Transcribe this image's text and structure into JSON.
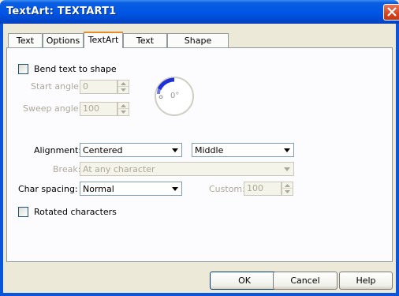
{
  "window": {
    "title": "TextArt: TEXTART1",
    "close_icon": "close-icon",
    "accent_color": "#0055e5"
  },
  "tabs": [
    {
      "label": "Text",
      "active": false
    },
    {
      "label": "Options",
      "active": false
    },
    {
      "label": "TextArt",
      "active": true
    },
    {
      "label": "Text Color",
      "active": false
    },
    {
      "label": "Shape settings",
      "active": false
    }
  ],
  "bend": {
    "checkbox_label": "Bend text to shape",
    "checked": false,
    "start_angle_label": "Start angle:",
    "start_angle_value": "0",
    "sweep_angle_label": "Sweep angle:",
    "sweep_angle_value": "100",
    "dial_label": "0°"
  },
  "alignment": {
    "label": "Alignment:",
    "horizontal_value": "Centered",
    "vertical_value": "Middle"
  },
  "break": {
    "label": "Break:",
    "value": "At any character"
  },
  "char_spacing": {
    "label": "Char spacing:",
    "value": "Normal",
    "custom_label": "Custom:",
    "custom_value": "100"
  },
  "rotated": {
    "checkbox_label": "Rotated characters",
    "checked": false
  },
  "buttons": {
    "ok": "OK",
    "cancel": "Cancel",
    "help": "Help"
  }
}
